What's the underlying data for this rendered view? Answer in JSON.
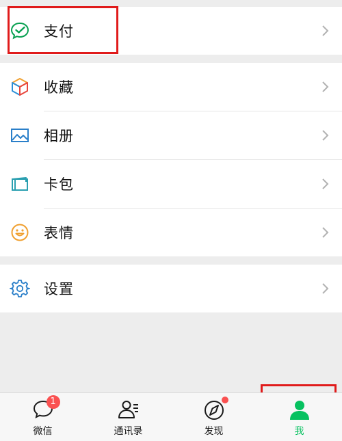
{
  "menu": {
    "pay": {
      "label": "支付",
      "icon": "pay-check-icon"
    },
    "favorites": {
      "label": "收藏",
      "icon": "cube-icon"
    },
    "album": {
      "label": "相册",
      "icon": "picture-icon"
    },
    "card_wallet": {
      "label": "卡包",
      "icon": "card-icon"
    },
    "stickers": {
      "label": "表情",
      "icon": "smiley-icon"
    },
    "settings": {
      "label": "设置",
      "icon": "gear-icon"
    }
  },
  "tabbar": {
    "chats": {
      "label": "微信",
      "badge": "1",
      "icon": "chat-bubble-icon"
    },
    "contacts": {
      "label": "通讯录",
      "icon": "contacts-icon"
    },
    "discover": {
      "label": "发现",
      "icon": "compass-icon",
      "has_dot": true
    },
    "me": {
      "label": "我",
      "icon": "person-icon",
      "active": true
    }
  },
  "colors": {
    "accent_green": "#07c160",
    "badge_red": "#fa5151",
    "highlight_red": "#e01b1b",
    "background": "#ededed"
  }
}
